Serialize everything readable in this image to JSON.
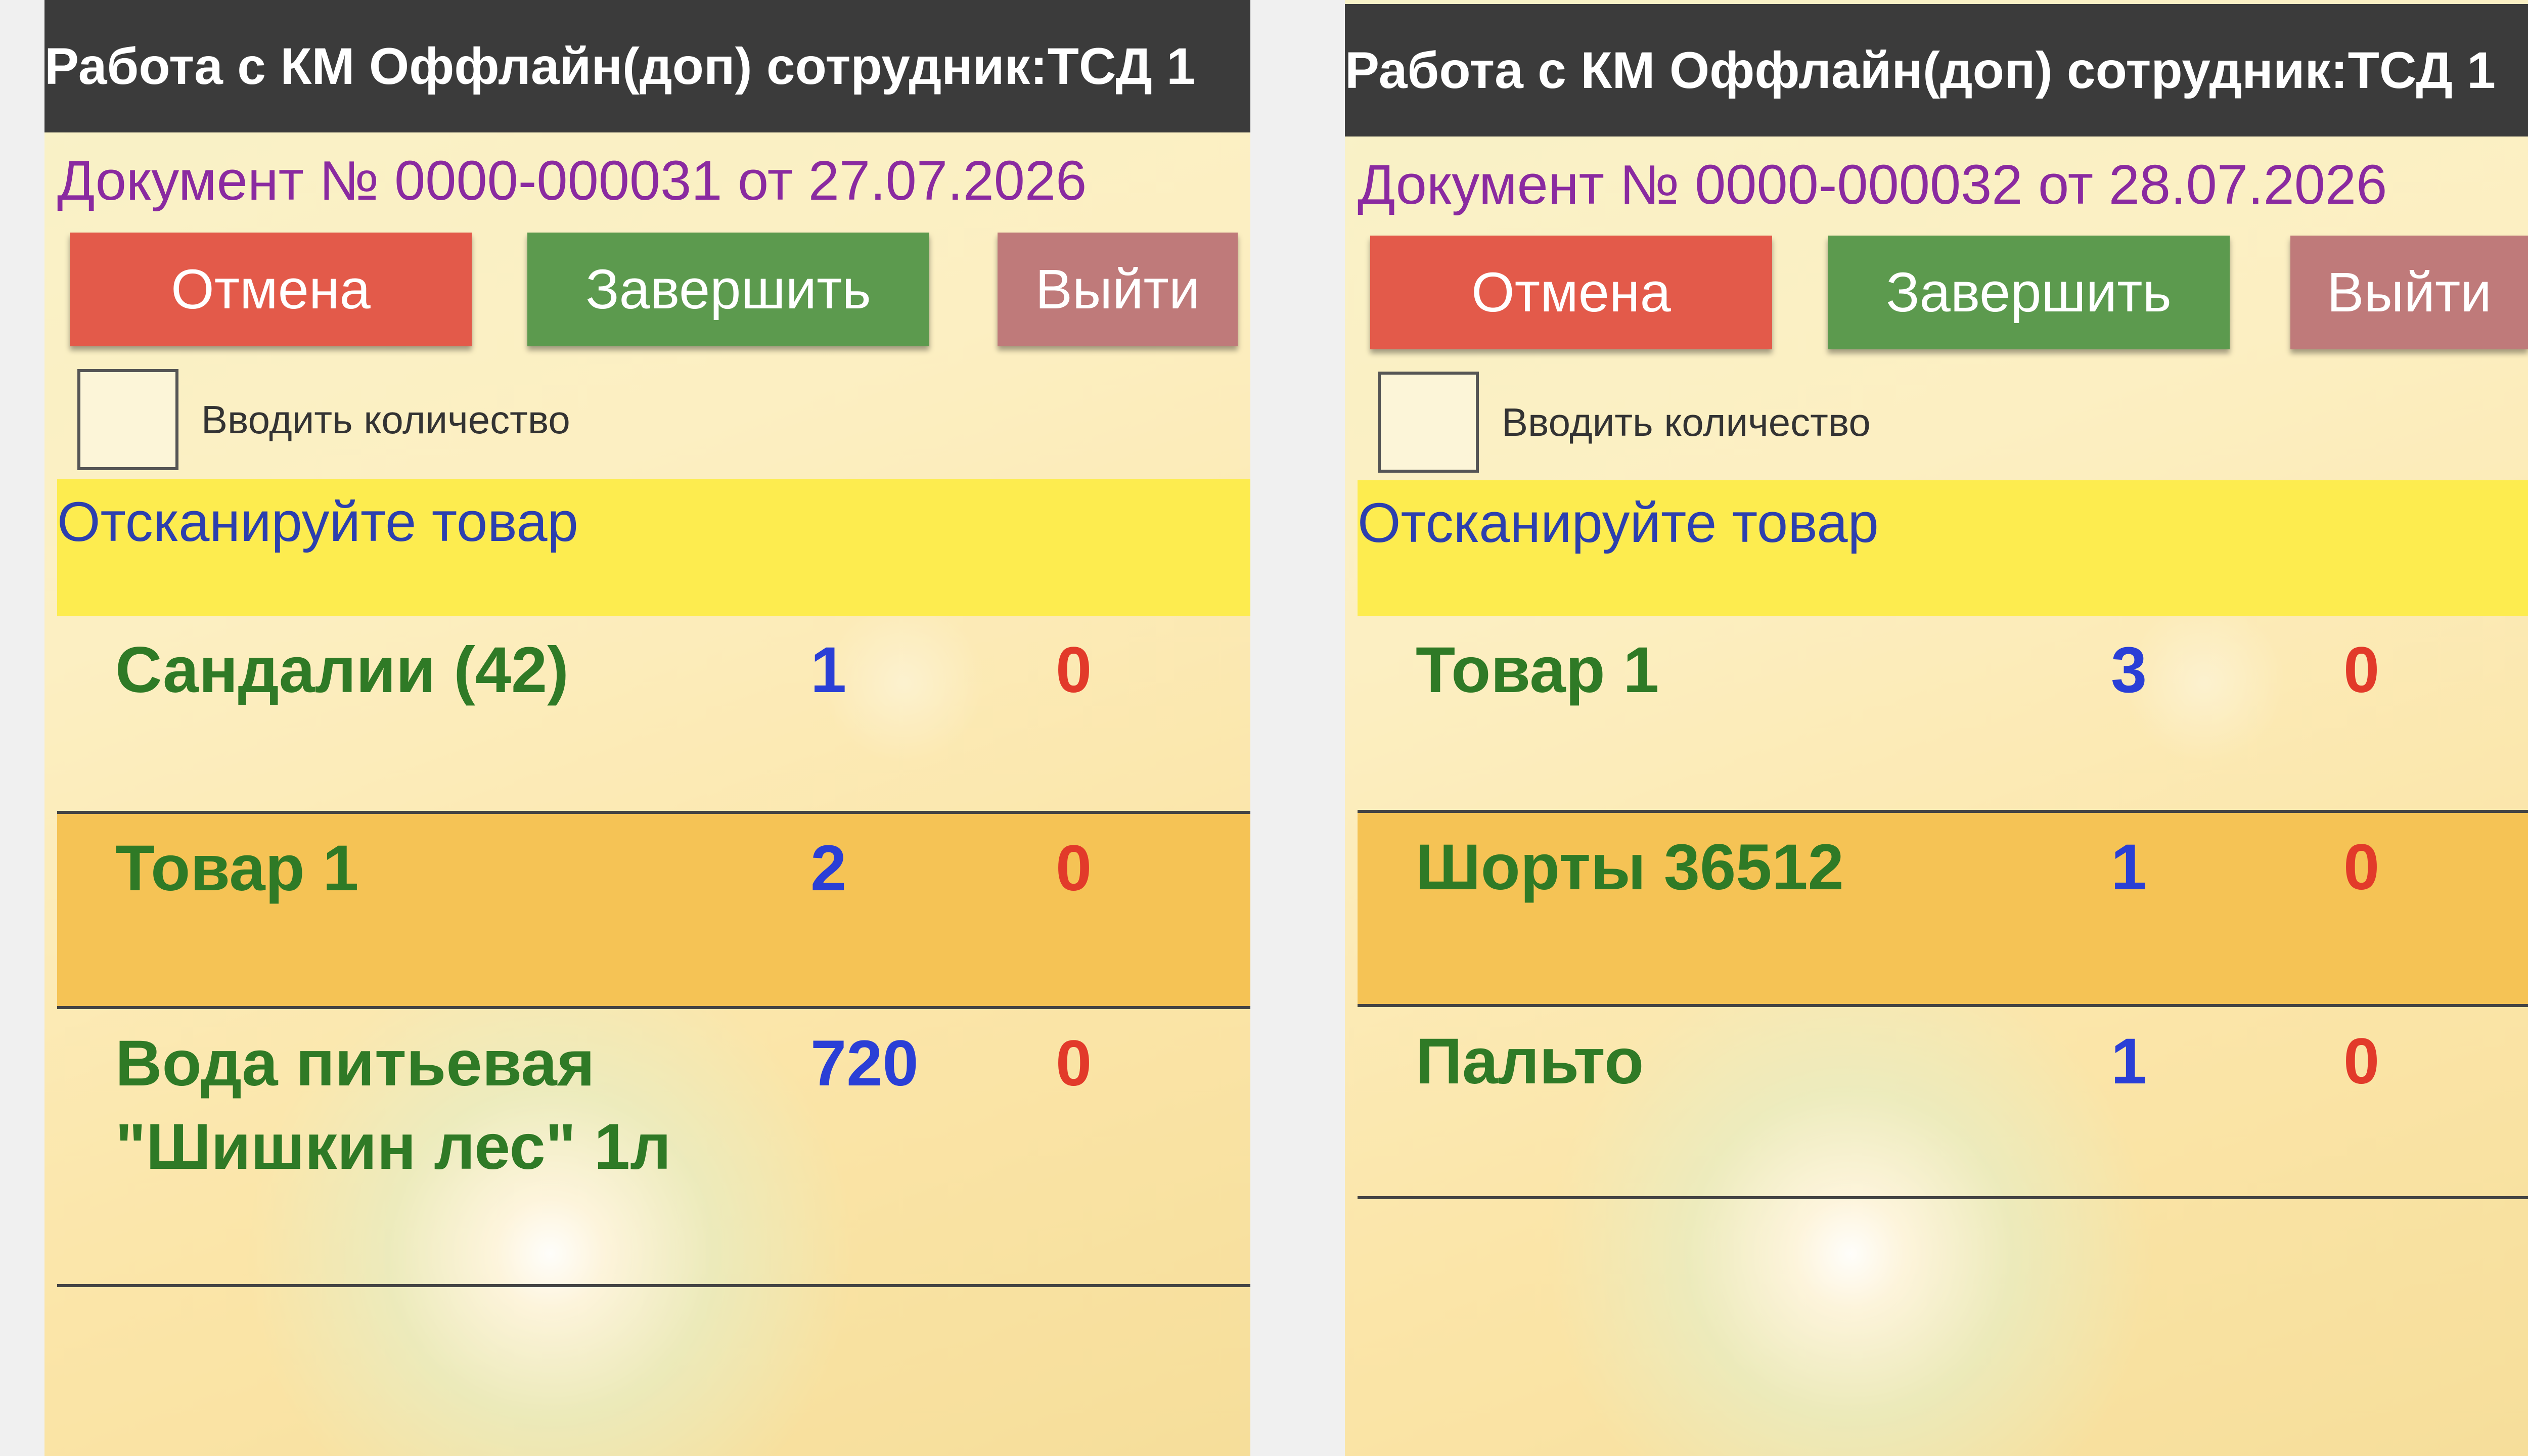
{
  "screens": [
    {
      "title": "Работа с КМ Оффлайн(доп) сотрудник:ТСД 1",
      "document": "Документ № 0000-000031 от 27.07.2026",
      "buttons": {
        "cancel": "Отмена",
        "finish": "Завершить",
        "exit": "Выйти"
      },
      "checkbox": {
        "label": "Вводить количество",
        "checked": false
      },
      "prompt": "Отсканируйте товар",
      "items": [
        {
          "name": "Сандалии (42)",
          "qty": "1",
          "scanned": "0",
          "highlighted": false
        },
        {
          "name": "Товар 1",
          "qty": "2",
          "scanned": "0",
          "highlighted": true
        },
        {
          "name": "Вода питьевая \"Шишкин лес\" 1л",
          "qty": "720",
          "scanned": "0",
          "highlighted": false
        }
      ]
    },
    {
      "title": "Работа с КМ Оффлайн(доп) сотрудник:ТСД 1",
      "document": "Документ № 0000-000032 от 28.07.2026",
      "buttons": {
        "cancel": "Отмена",
        "finish": "Завершить",
        "exit": "Выйти"
      },
      "checkbox": {
        "label": "Вводить количество",
        "checked": false
      },
      "prompt": "Отсканируйте товар",
      "items": [
        {
          "name": "Товар 1",
          "qty": "3",
          "scanned": "0",
          "highlighted": false
        },
        {
          "name": "Шорты 36512",
          "qty": "1",
          "scanned": "0",
          "highlighted": true
        },
        {
          "name": "Пальто",
          "qty": "1",
          "scanned": "0",
          "highlighted": false
        }
      ]
    }
  ],
  "colors": {
    "titlebar": "#3b3b3b",
    "cancel_button": "#e35a4a",
    "finish_button": "#5c9a4e",
    "exit_button": "#bf7a7a",
    "prompt_background": "#fdec4f",
    "highlight_row": "#f5c355",
    "item_name": "#2f7a26",
    "item_qty": "#2a3fd6",
    "item_scanned": "#e23a2a",
    "document_text": "#8a2aa0"
  }
}
